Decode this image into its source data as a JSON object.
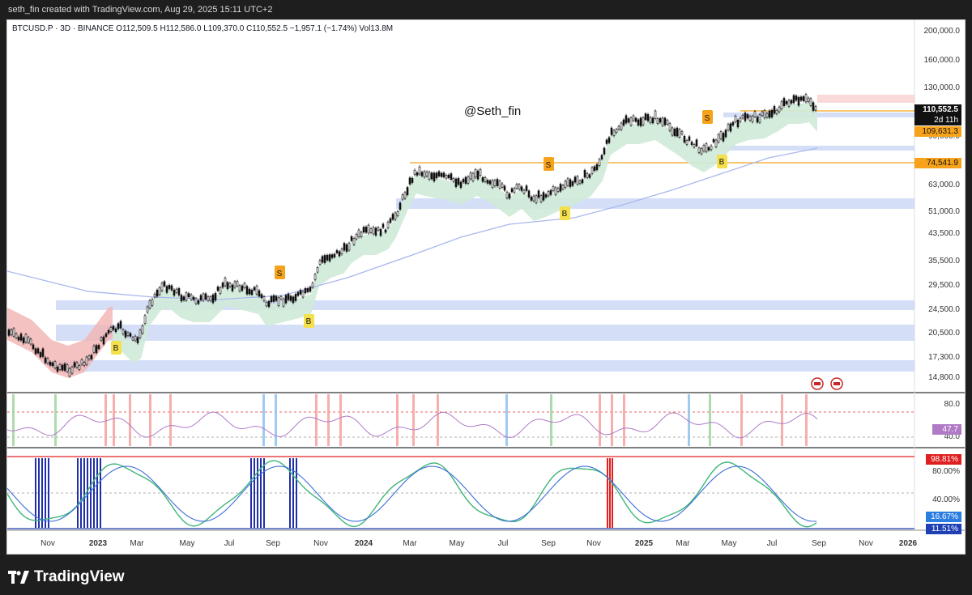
{
  "topbar": {
    "credit": "seth_fin created with TradingView.com, Aug 29, 2025 15:11 UTC+2"
  },
  "header": {
    "symbol": "BTCUSD.P · 3D · BINANCE",
    "ohlc": "O112,509.5  H112,586.0  L109,370.0  C110,552.5  −1,957.1 (−1.74%)  Vol13.8M"
  },
  "watermark": "@Seth_fin",
  "price_axis": [
    "200,000.0",
    "160,000.0",
    "130,000.0",
    "90,000.0",
    "63,000.0",
    "51,000.0",
    "43,500.0",
    "35,500.0",
    "29,500.0",
    "24,500.0",
    "20,500.0",
    "17,300.0",
    "14,800.0"
  ],
  "price_labels": {
    "last": "110,552.5",
    "countdown": "2d 11h",
    "level1": "109,631.3",
    "level2": "74,541.9"
  },
  "rsi_axis": [
    "80.0",
    "40.0"
  ],
  "rsi_value": "47.7",
  "stoch_axis": [
    "80.00%",
    "40.00%"
  ],
  "stoch_labels": {
    "upper": "98.81%",
    "k": "16.67%",
    "d": "11.51%"
  },
  "time_axis": [
    {
      "label": "Nov",
      "bold": false
    },
    {
      "label": "2023",
      "bold": true
    },
    {
      "label": "Mar",
      "bold": false
    },
    {
      "label": "May",
      "bold": false
    },
    {
      "label": "Jul",
      "bold": false
    },
    {
      "label": "Sep",
      "bold": false
    },
    {
      "label": "Nov",
      "bold": false
    },
    {
      "label": "2024",
      "bold": true
    },
    {
      "label": "Mar",
      "bold": false
    },
    {
      "label": "May",
      "bold": false
    },
    {
      "label": "Jul",
      "bold": false
    },
    {
      "label": "Sep",
      "bold": false
    },
    {
      "label": "Nov",
      "bold": false
    },
    {
      "label": "2025",
      "bold": true
    },
    {
      "label": "Mar",
      "bold": false
    },
    {
      "label": "May",
      "bold": false
    },
    {
      "label": "Jul",
      "bold": false
    },
    {
      "label": "Sep",
      "bold": false
    },
    {
      "label": "Nov",
      "bold": false
    },
    {
      "label": "2026",
      "bold": true
    }
  ],
  "signals": {
    "buy": "B",
    "sell": "S"
  },
  "footer": {
    "brand": "TradingView"
  },
  "colors": {
    "orange": "#f7a21b",
    "up": "#111111",
    "blue_zone": "#b7c9f2",
    "red_zone": "#f3b3b3",
    "green_band": "#cfead8",
    "ma": "#a9b8ee",
    "rsi": "#b07ac7",
    "stoch_line": "#3b6fd8"
  }
}
